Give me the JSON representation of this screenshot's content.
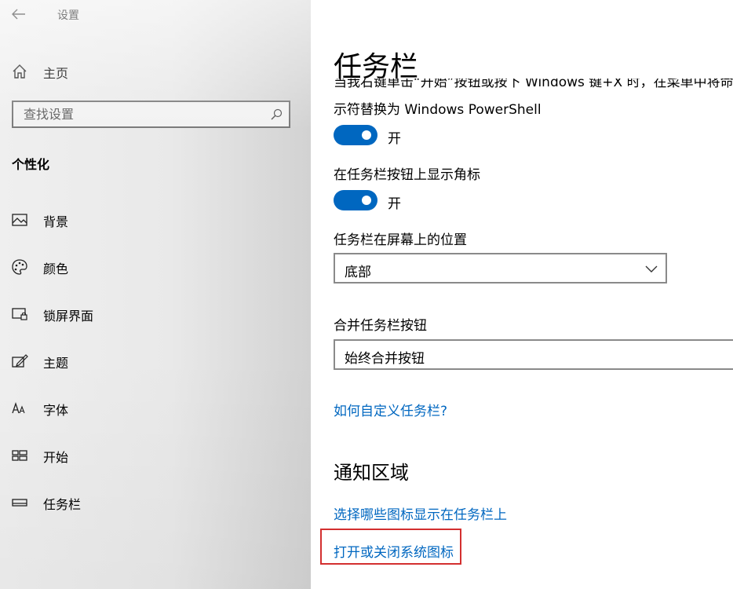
{
  "app": {
    "title": "设置"
  },
  "sidebar": {
    "home_label": "主页",
    "search": {
      "placeholder": "查找设置"
    },
    "section_heading": "个性化",
    "items": [
      {
        "label": "背景",
        "icon": "picture-icon"
      },
      {
        "label": "颜色",
        "icon": "palette-icon"
      },
      {
        "label": "锁屏界面",
        "icon": "lock-screen-icon"
      },
      {
        "label": "主题",
        "icon": "theme-icon"
      },
      {
        "label": "字体",
        "icon": "font-icon"
      },
      {
        "label": "开始",
        "icon": "start-icon"
      },
      {
        "label": "任务栏",
        "icon": "taskbar-icon"
      }
    ]
  },
  "main": {
    "title": "任务栏",
    "powershell_text_cut": "当我右键单击“开始”按钮或按下 Windows 键+X 时，在菜单中将命令提",
    "powershell_text": "示符替换为 Windows PowerShell",
    "toggle1_state": "开",
    "badges_label": "在任务栏按钮上显示角标",
    "toggle2_state": "开",
    "position_label": "任务栏在屏幕上的位置",
    "position_value": "底部",
    "combine_label": "合并任务栏按钮",
    "combine_value": "始终合并按钮",
    "help_link": "如何自定义任务栏?",
    "notification_heading": "通知区域",
    "notification_link1": "选择哪些图标显示在任务栏上",
    "notification_link2": "打开或关闭系统图标"
  },
  "colors": {
    "accent": "#0067c0",
    "highlight": "#d32f2f"
  }
}
